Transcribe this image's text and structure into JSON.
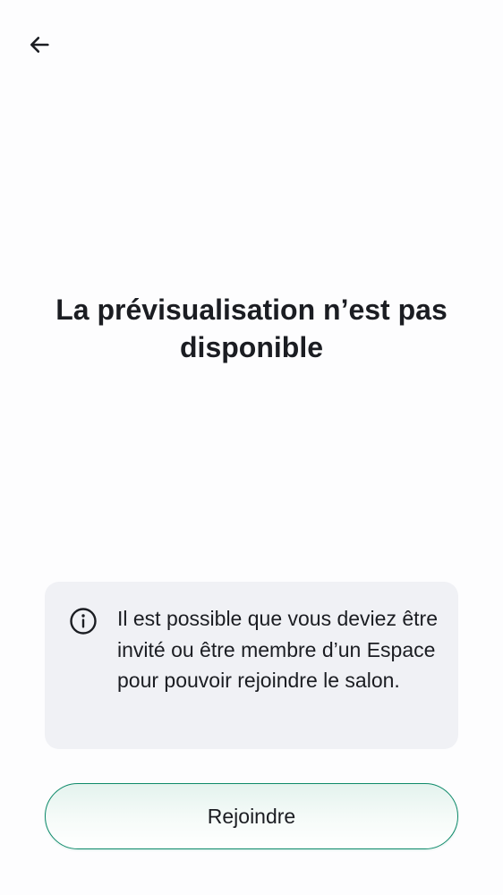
{
  "header": {
    "back_icon": "arrow-left-icon"
  },
  "main": {
    "title": "La prévisualisation n’est pas disponible"
  },
  "info_card": {
    "icon": "info-circle-icon",
    "message": "Il est possible que vous deviez être invité ou être membre d’un Espace pour pouvoir rejoindre le salon."
  },
  "actions": {
    "join_label": "Rejoindre"
  },
  "colors": {
    "accent": "#0e8a6a",
    "card_background": "#f0f1f5",
    "text": "#1b1d22"
  }
}
